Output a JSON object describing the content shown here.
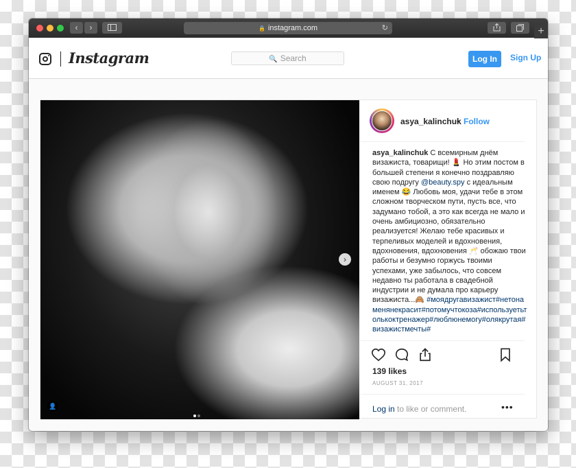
{
  "browser": {
    "url": "instagram.com",
    "back_icon": "‹",
    "forward_icon": "›",
    "new_tab_icon": "+"
  },
  "header": {
    "wordmark": "Instagram",
    "search_placeholder": "Search",
    "login_label": "Log In",
    "signup_label": "Sign Up"
  },
  "post": {
    "username": "asya_kalinchuk",
    "bullet": "•",
    "follow_label": "Follow",
    "caption_user": "asya_kalinchuk",
    "caption_part1": "С всемирным днём визажиста, товарищи! 💄 Но этим постом в большей степени я конечно поздравляю свою подругу",
    "mention": "@beauty.spy",
    "caption_part2": "с идеальным именем 😂 Любовь моя, удачи тебе в этом сложном творческом пути, пусть все, что задумано тобой, а это как всегда не мало и очень амбициозно, обязательно реализуется! Желаю тебе красивых и терпеливых моделей и вдохновения, вдохновения, вдохновения 🥂 обожаю твои работы и безумно горжусь твоими успехами, уже забылось, что совсем недавно ты работала в свадебной индустрии и не думала про карьеру визажиста...🙈",
    "hashtags": "#моядругавизажист#нетонаменянекрасит#потомучтокоза#используетьтолькоктренажер#люблюнемогу#олякрутая#визажистмечты#",
    "likes": "139 likes",
    "date": "AUGUST 31, 2017",
    "login_link": "Log in",
    "comment_suffix": "to like or comment.",
    "more_label": "•••"
  }
}
